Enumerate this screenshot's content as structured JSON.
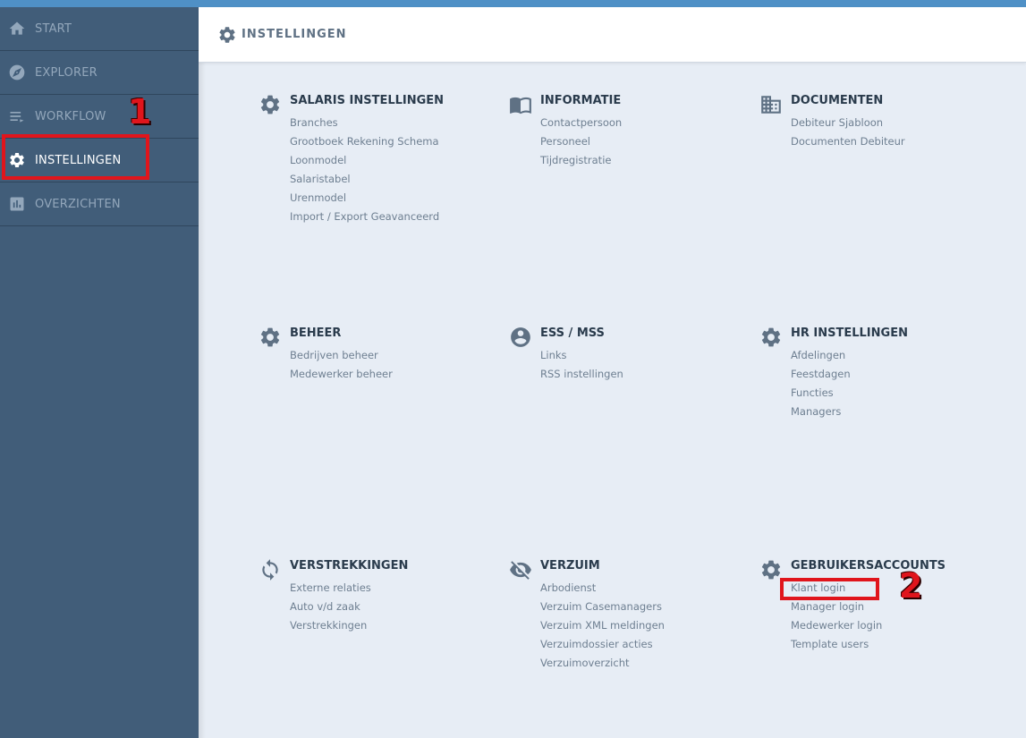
{
  "sidebar": {
    "items": [
      {
        "label": "START",
        "icon": "home-icon",
        "active": false
      },
      {
        "label": "EXPLORER",
        "icon": "compass-icon",
        "active": false
      },
      {
        "label": "WORKFLOW",
        "icon": "workflow-icon",
        "active": false
      },
      {
        "label": "INSTELLINGEN",
        "icon": "gear-icon",
        "active": true
      },
      {
        "label": "OVERZICHTEN",
        "icon": "bar-chart-icon",
        "active": false
      }
    ]
  },
  "header": {
    "title": "INSTELLINGEN",
    "icon": "gear-icon"
  },
  "annotations": {
    "marker_1": "1",
    "marker_2": "2",
    "color": "#e0151c"
  },
  "colors": {
    "topbar": "#4f90c6",
    "sidebar": "#415d79",
    "content_bg": "#e7edf5"
  },
  "sections": [
    {
      "title": "SALARIS INSTELLINGEN",
      "icon": "gear-icon",
      "links": [
        "Branches",
        "Grootboek Rekening Schema",
        "Loonmodel",
        "Salaristabel",
        "Urenmodel",
        "Import / Export Geavanceerd"
      ]
    },
    {
      "title": "INFORMATIE",
      "icon": "book-icon",
      "links": [
        "Contactpersoon",
        "Personeel",
        "Tijdregistratie"
      ]
    },
    {
      "title": "DOCUMENTEN",
      "icon": "building-icon",
      "links": [
        "Debiteur Sjabloon",
        "Documenten Debiteur"
      ]
    },
    {
      "title": "BEHEER",
      "icon": "gear-icon",
      "links": [
        "Bedrijven beheer",
        "Medewerker beheer"
      ]
    },
    {
      "title": "ESS / MSS",
      "icon": "user-circle-icon",
      "links": [
        "Links",
        "RSS instellingen"
      ]
    },
    {
      "title": "HR INSTELLINGEN",
      "icon": "gear-icon",
      "links": [
        "Afdelingen",
        "Feestdagen",
        "Functies",
        "Managers"
      ]
    },
    {
      "title": "VERSTREKKINGEN",
      "icon": "refresh-icon",
      "links": [
        "Externe relaties",
        "Auto v/d zaak",
        "Verstrekkingen"
      ]
    },
    {
      "title": "VERZUIM",
      "icon": "eye-off-icon",
      "links": [
        "Arbodienst",
        "Verzuim Casemanagers",
        "Verzuim XML meldingen",
        "Verzuimdossier acties",
        "Verzuimoverzicht"
      ]
    },
    {
      "title": "GEBRUIKERSACCOUNTS",
      "icon": "gear-icon",
      "links": [
        "Klant login",
        "Manager login",
        "Medewerker login",
        "Template users"
      ]
    }
  ],
  "partial_icons": [
    "gear-icon",
    "flag-icon",
    "gear-icon"
  ]
}
